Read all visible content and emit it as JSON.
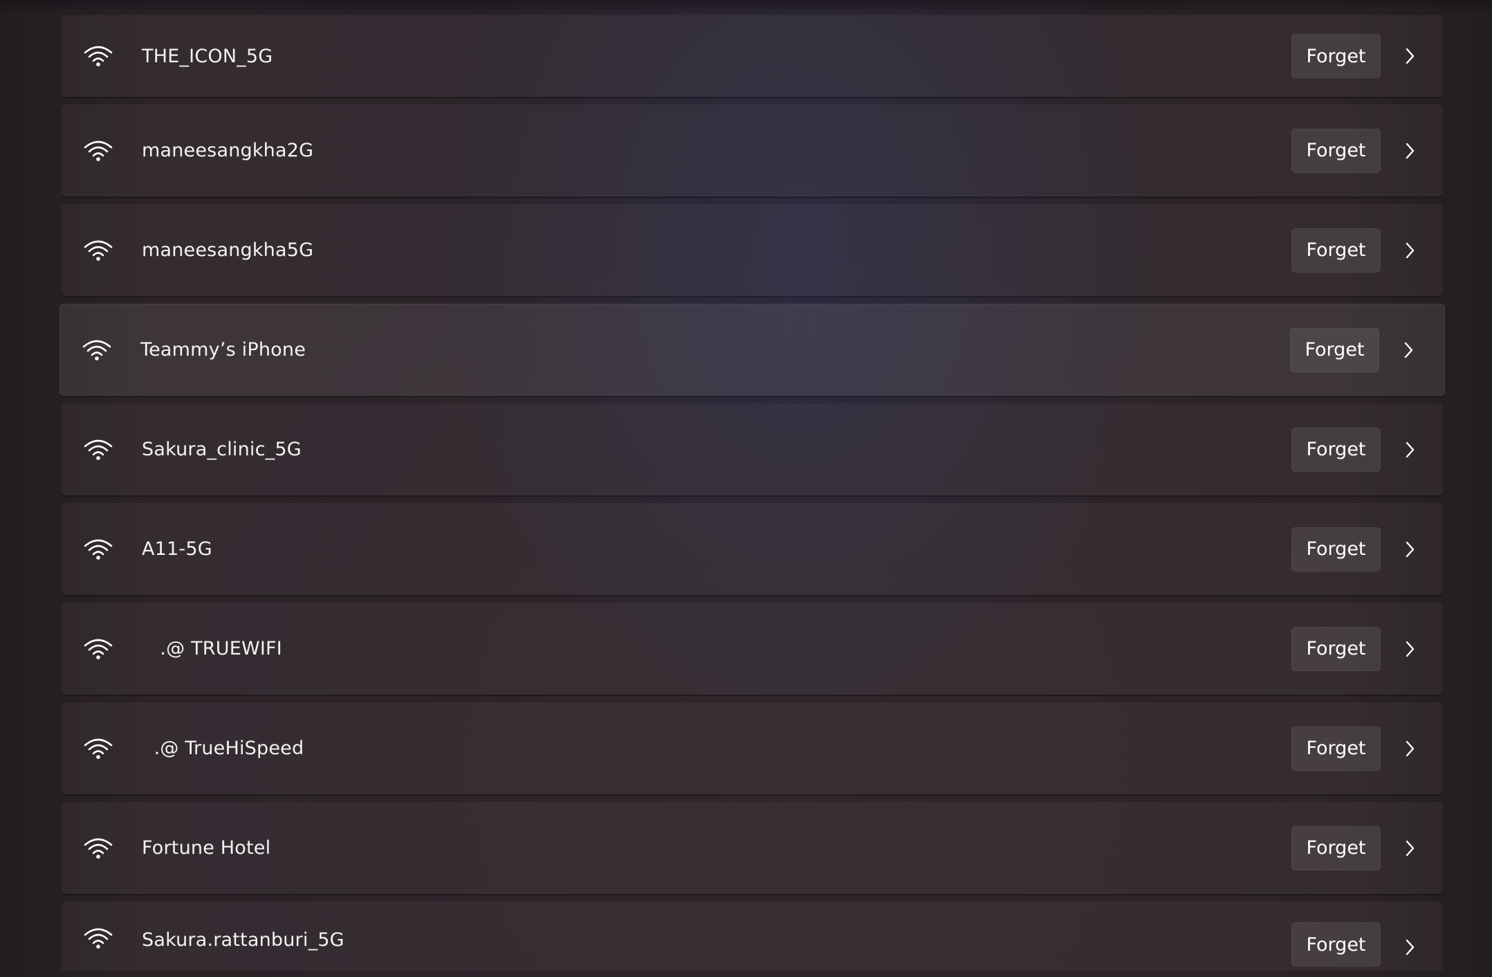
{
  "networks": [
    {
      "ssid": "THE_ICON_5G",
      "forget_label": "Forget",
      "icon": "wifi-icon"
    },
    {
      "ssid": "maneesangkha2G",
      "forget_label": "Forget",
      "icon": "wifi-icon"
    },
    {
      "ssid": "maneesangkha5G",
      "forget_label": "Forget",
      "icon": "wifi-icon"
    },
    {
      "ssid": "Teammy’s iPhone",
      "forget_label": "Forget",
      "icon": "wifi-icon"
    },
    {
      "ssid": "Sakura_clinic_5G",
      "forget_label": "Forget",
      "icon": "wifi-icon"
    },
    {
      "ssid": "A11-5G",
      "forget_label": "Forget",
      "icon": "wifi-icon"
    },
    {
      "ssid": "   .@ TRUEWIFI",
      "forget_label": "Forget",
      "icon": "wifi-icon"
    },
    {
      "ssid": "  .@ TrueHiSpeed",
      "forget_label": "Forget",
      "icon": "wifi-icon"
    },
    {
      "ssid": "Fortune Hotel",
      "forget_label": "Forget",
      "icon": "wifi-icon"
    },
    {
      "ssid": "Sakura.rattanburi_5G",
      "forget_label": "Forget",
      "icon": "wifi-icon"
    }
  ],
  "colors": {
    "background": "#2a2329",
    "row": "#342d32",
    "button": "#3d373b",
    "text": "#ffffff"
  }
}
